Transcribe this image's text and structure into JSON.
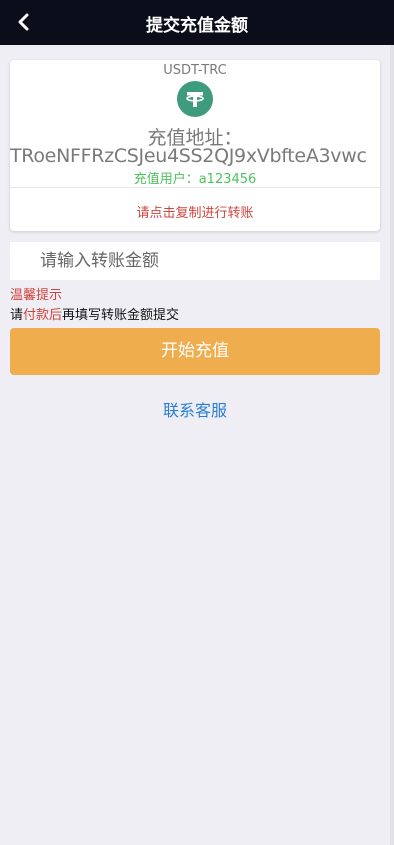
{
  "header": {
    "title": "提交充值金额",
    "back_icon": "chevron-left-icon"
  },
  "deposit_card": {
    "chain": "USDT-TRC",
    "logo_icon": "tether-icon",
    "logo_color": "#3f9b7d",
    "address_title": "充值地址：",
    "address": "TRoeNFFRzCSJeu4SS2QJ9xVbfteA3vwc",
    "user_line": "充值用户：a123456",
    "copy_hint": "请点击复制进行转账"
  },
  "amount_input": {
    "value": "",
    "placeholder": "请输入转账金额"
  },
  "tips": {
    "title": "温馨提示",
    "prefix": "请",
    "highlight": "付款后",
    "suffix": "再填写转账金额提交"
  },
  "submit_label": "开始充值",
  "contact_label": "联系客服",
  "colors": {
    "header_bg": "#0c0d1a",
    "accent_button": "#f0ad4e",
    "warning_text": "#d0443e",
    "success_text": "#4cc25c",
    "link": "#2a7fd4"
  }
}
